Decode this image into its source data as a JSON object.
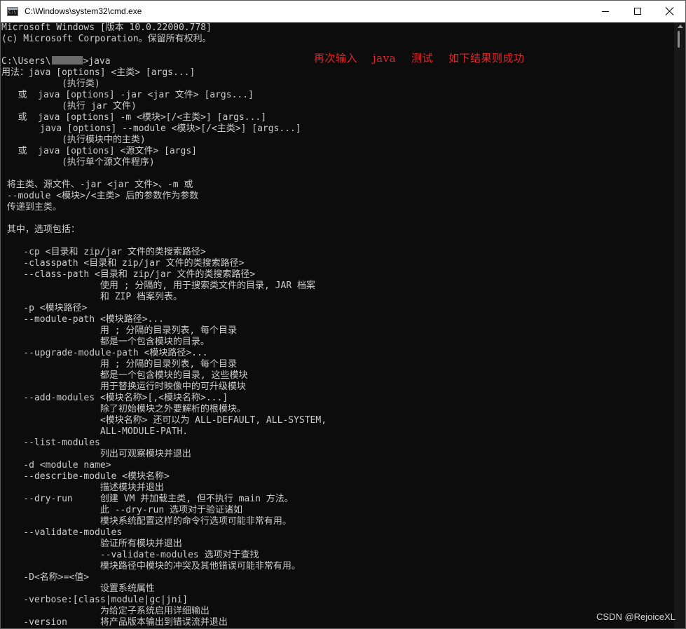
{
  "window": {
    "title": "C:\\Windows\\system32\\cmd.exe",
    "icon": "cmd-icon",
    "controls": {
      "minimize": "minimize-icon",
      "maximize": "maximize-icon",
      "close": "close-icon"
    }
  },
  "console": {
    "lines_before_prompt": [
      "Microsoft Windows [版本 10.0.22000.778]",
      "(c) Microsoft Corporation。保留所有权利。",
      ""
    ],
    "prompt_prefix": "C:\\Users\\",
    "prompt_suffix": ">java",
    "output_lines": [
      "用法：java [options] <主类> [args...]",
      "           (执行类)",
      "   或  java [options] -jar <jar 文件> [args...]",
      "           (执行 jar 文件)",
      "   或  java [options] -m <模块>[/<主类>] [args...]",
      "       java [options] --module <模块>[/<主类>] [args...]",
      "           (执行模块中的主类)",
      "   或  java [options] <源文件> [args]",
      "           (执行单个源文件程序)",
      "",
      " 将主类、源文件、-jar <jar 文件>、-m 或",
      " --module <模块>/<主类> 后的参数作为参数",
      " 传递到主类。",
      "",
      " 其中，选项包括：",
      "",
      "    -cp <目录和 zip/jar 文件的类搜索路径>",
      "    -classpath <目录和 zip/jar 文件的类搜索路径>",
      "    --class-path <目录和 zip/jar 文件的类搜索路径>",
      "                  使用 ; 分隔的, 用于搜索类文件的目录, JAR 档案",
      "                  和 ZIP 档案列表。",
      "    -p <模块路径>",
      "    --module-path <模块路径>...",
      "                  用 ; 分隔的目录列表, 每个目录",
      "                  都是一个包含模块的目录。",
      "    --upgrade-module-path <模块路径>...",
      "                  用 ; 分隔的目录列表, 每个目录",
      "                  都是一个包含模块的目录, 这些模块",
      "                  用于替换运行时映像中的可升级模块",
      "    --add-modules <模块名称>[,<模块名称>...]",
      "                  除了初始模块之外要解析的根模块。",
      "                  <模块名称> 还可以为 ALL-DEFAULT, ALL-SYSTEM,",
      "                  ALL-MODULE-PATH.",
      "    --list-modules",
      "                  列出可观察模块并退出",
      "    -d <module name>",
      "    --describe-module <模块名称>",
      "                  描述模块并退出",
      "    --dry-run     创建 VM 并加载主类, 但不执行 main 方法。",
      "                  此 --dry-run 选项对于验证诸如",
      "                  模块系统配置这样的命令行选项可能非常有用。",
      "    --validate-modules",
      "                  验证所有模块并退出",
      "                  --validate-modules 选项对于查找",
      "                  模块路径中模块的冲突及其他错误可能非常有用。",
      "    -D<名称>=<值>",
      "                  设置系统属性",
      "    -verbose:[class|module|gc|jni]",
      "                  为给定子系统启用详细输出",
      "    -version      将产品版本输出到错误流并退出"
    ]
  },
  "annotation": {
    "parts": [
      "再次输入",
      "java",
      "测试",
      "如下结果则成功"
    ],
    "color": "#e4262d"
  },
  "watermark": "CSDN @RejoiceXL",
  "colors": {
    "console_bg": "#0c0c0c",
    "console_fg": "#cccccc",
    "titlebar_bg": "#ffffff"
  }
}
